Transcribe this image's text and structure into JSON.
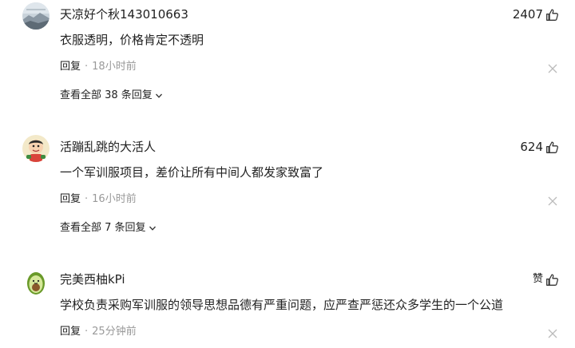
{
  "comments": [
    {
      "username": "天凉好个秋143010663",
      "likes": "2407",
      "text": "衣服透明，价格肯定不透明",
      "reply_label": "回复",
      "dot": "·",
      "time": "18小时前",
      "view_replies": "查看全部 38 条回复",
      "avatar_icon": "landscape-photo-avatar"
    },
    {
      "username": "活蹦乱跳的大活人",
      "likes": "624",
      "text": "一个军训服项目，差价让所有中间人都发家致富了",
      "reply_label": "回复",
      "dot": "·",
      "time": "16小时前",
      "view_replies": "查看全部 7 条回复",
      "avatar_icon": "cartoon-kid-avatar"
    },
    {
      "username": "完美西柚kPi",
      "likes": "赞",
      "text": "学校负责采购军训服的领导思想品德有严重问题，应严查严惩还众多学生的一个公道",
      "reply_label": "回复",
      "dot": "·",
      "time": "25分钟前",
      "avatar_icon": "avocado-avatar"
    }
  ],
  "colors": {
    "text": "#222222",
    "muted": "#999999",
    "icon": "#333333",
    "close": "#bbbbbb"
  }
}
